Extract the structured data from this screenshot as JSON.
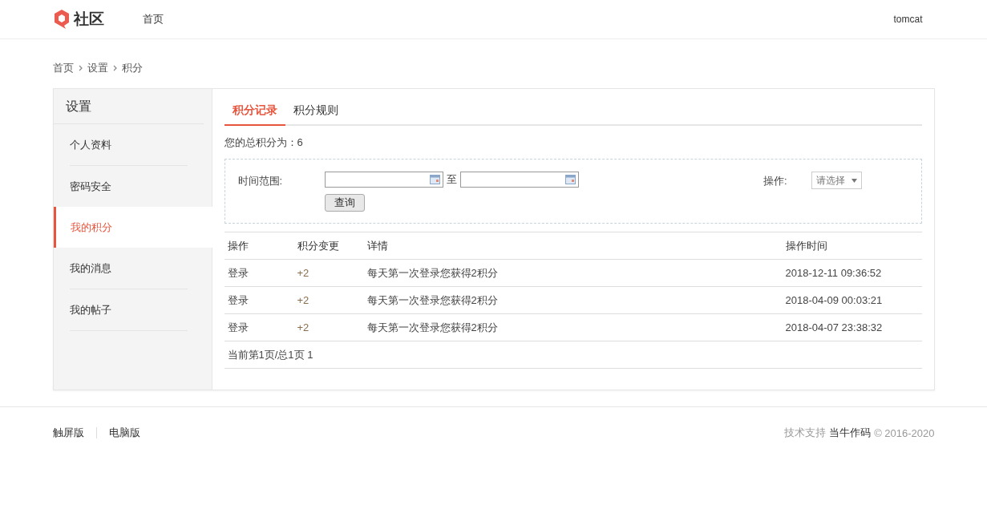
{
  "header": {
    "logo_text": "社区",
    "nav": [
      {
        "label": "首页",
        "selected": false
      }
    ],
    "user": "tomcat"
  },
  "breadcrumb": [
    "首页",
    "设置",
    "积分"
  ],
  "sidebar": {
    "title": "设置",
    "items": [
      {
        "label": "个人资料",
        "selected": false
      },
      {
        "label": "密码安全",
        "selected": false
      },
      {
        "label": "我的积分",
        "selected": true
      },
      {
        "label": "我的消息",
        "selected": false
      },
      {
        "label": "我的帖子",
        "selected": false
      }
    ]
  },
  "tabs": [
    {
      "label": "积分记录",
      "selected": true
    },
    {
      "label": "积分规则",
      "selected": false
    }
  ],
  "total": "您的总积分为：6",
  "filter": {
    "range_label": "时间范围:",
    "separator": "至",
    "query_button": "查询",
    "action_label": "操作:",
    "action_placeholder": "请选择"
  },
  "table": {
    "columns": [
      "操作",
      "积分变更",
      "详情",
      "操作时间"
    ],
    "rows": [
      [
        "登录",
        "+2",
        "每天第一次登录您获得2积分",
        "2018-12-11 09:36:52"
      ],
      [
        "登录",
        "+2",
        "每天第一次登录您获得2积分",
        "2018-04-09 00:03:21"
      ],
      [
        "登录",
        "+2",
        "每天第一次登录您获得2积分",
        "2018-04-07 23:38:32"
      ]
    ]
  },
  "pagination": "当前第1页/总1页 1",
  "footer": {
    "links": [
      "触屏版",
      "电脑版"
    ],
    "support_label": "技术支持",
    "support_name": "当牛作码",
    "copyright": "© 2016-2020"
  }
}
